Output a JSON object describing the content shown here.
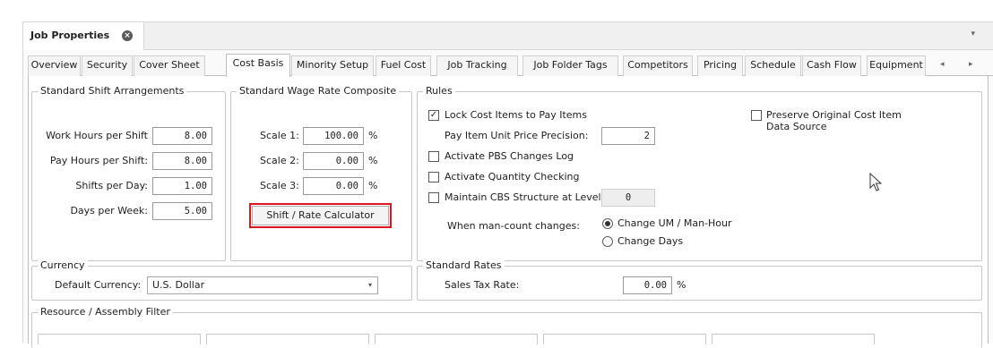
{
  "window": {
    "doc_tab_title": "Job Properties",
    "close_glyph": "×",
    "dropdown_glyph": "▾"
  },
  "tabs": [
    "Overview",
    "Security",
    "Cover Sheet",
    "Cost Basis",
    "Minority Setup",
    "Fuel Cost",
    "Job Tracking",
    "Job Folder Tags",
    "Competitors",
    "Pricing",
    "Schedule",
    "Cash Flow",
    "Equipment"
  ],
  "active_tab": "Cost Basis",
  "tab_scroll": {
    "left": "◂",
    "right": "▸"
  },
  "shift": {
    "title": "Standard Shift Arrangements",
    "work_hours_label": "Work Hours per Shift",
    "work_hours_value": "8.00",
    "pay_hours_label": "Pay Hours per Shift:",
    "pay_hours_value": "8.00",
    "shifts_label": "Shifts per Day:",
    "shifts_value": "1.00",
    "days_label": "Days per Week:",
    "days_value": "5.00"
  },
  "wage": {
    "title": "Standard Wage Rate Composite",
    "scale1_label": "Scale 1:",
    "scale1_value": "100.00",
    "scale2_label": "Scale 2:",
    "scale2_value": "0.00",
    "scale3_label": "Scale 3:",
    "scale3_value": "0.00",
    "percent": "%",
    "calc_button": "Shift / Rate Calculator"
  },
  "rules": {
    "title": "Rules",
    "lock_label": "Lock Cost Items to Pay Items",
    "lock_checked": true,
    "precision_label": "Pay Item Unit Price Precision:",
    "precision_value": "2",
    "pbs_label": "Activate PBS Changes Log",
    "qty_label": "Activate Quantity Checking",
    "cbs_label": "Maintain CBS Structure at Level:",
    "cbs_value": "0",
    "preserve_label_1": "Preserve Original Cost Item",
    "preserve_label_2": "Data Source",
    "mancount_label": "When man-count changes:",
    "option_um": "Change UM / Man-Hour",
    "option_days": "Change Days",
    "selected_option": "Change UM / Man-Hour",
    "check_glyph": "✓"
  },
  "currency": {
    "title": "Currency",
    "default_label": "Default Currency:",
    "default_value": "U.S. Dollar"
  },
  "standard_rates": {
    "title": "Standard Rates",
    "sales_tax_label": "Sales Tax Rate:",
    "sales_tax_value": "0.00",
    "percent": "%"
  },
  "filter": {
    "title": "Resource / Assembly Filter"
  }
}
